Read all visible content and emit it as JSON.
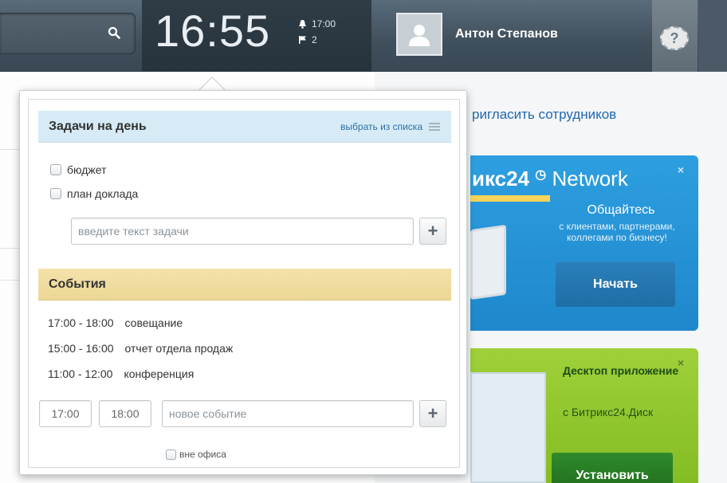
{
  "topbar": {
    "clock": "16:55",
    "alarm_time": "17:00",
    "flag_count": "2",
    "user_name": "Антон Степанов",
    "help_symbol": "?"
  },
  "background": {
    "invite_link": "ригласить сотрудников",
    "network": {
      "logo_prefix": "икс",
      "logo_num": "24",
      "logo_word": "Network",
      "heading": "Общайтесь",
      "text": "с клиентами, партнерами, коллегами по бизнесу!",
      "button": "Начать",
      "close": "×"
    },
    "desktop": {
      "heading": "Десктоп приложение",
      "text": "с Битрикс24.Диск",
      "button": "Установить",
      "close": "×"
    }
  },
  "tasks": {
    "title": "Задачи на день",
    "pick_from_list": "выбрать из списка",
    "items": [
      {
        "label": "бюджет",
        "checked": false
      },
      {
        "label": "план доклада",
        "checked": false
      }
    ],
    "input_placeholder": "введите текст задачи",
    "add_symbol": "+"
  },
  "events": {
    "title": "События",
    "items": [
      {
        "time": "17:00 - 18:00",
        "label": "совещание"
      },
      {
        "time": "15:00 - 16:00",
        "label": "отчет отдела продаж"
      },
      {
        "time": "11:00 - 12:00",
        "label": "конференция"
      }
    ],
    "start_time": "17:00",
    "end_time": "18:00",
    "input_placeholder": "новое событие",
    "add_symbol": "+",
    "out_of_office": "вне офиса"
  },
  "colors": {
    "topbar": "#3f4f5c",
    "tasks_header": "#d6ebf5",
    "events_header": "#ecd795",
    "network_banner": "#1f87cc",
    "desktop_banner": "#84bd23",
    "link": "#2e6ea6"
  }
}
